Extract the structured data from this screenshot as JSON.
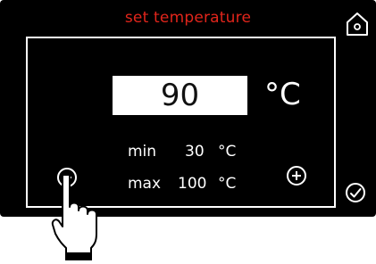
{
  "header": {
    "title": "set temperature"
  },
  "setpoint": {
    "value": "90",
    "unit": "°C"
  },
  "limits": {
    "min_label": "min",
    "min_value": "30",
    "min_unit": "°C",
    "max_label": "max",
    "max_value": "100",
    "max_unit": "°C"
  },
  "icons": {
    "home": "home-icon",
    "decrease": "minus-circle-icon",
    "increase": "plus-circle-icon",
    "confirm": "check-circle-icon",
    "pointer": "pointing-hand-icon"
  },
  "colors": {
    "screen": "#000000",
    "title": "#e1251b",
    "foreground": "#ffffff"
  }
}
